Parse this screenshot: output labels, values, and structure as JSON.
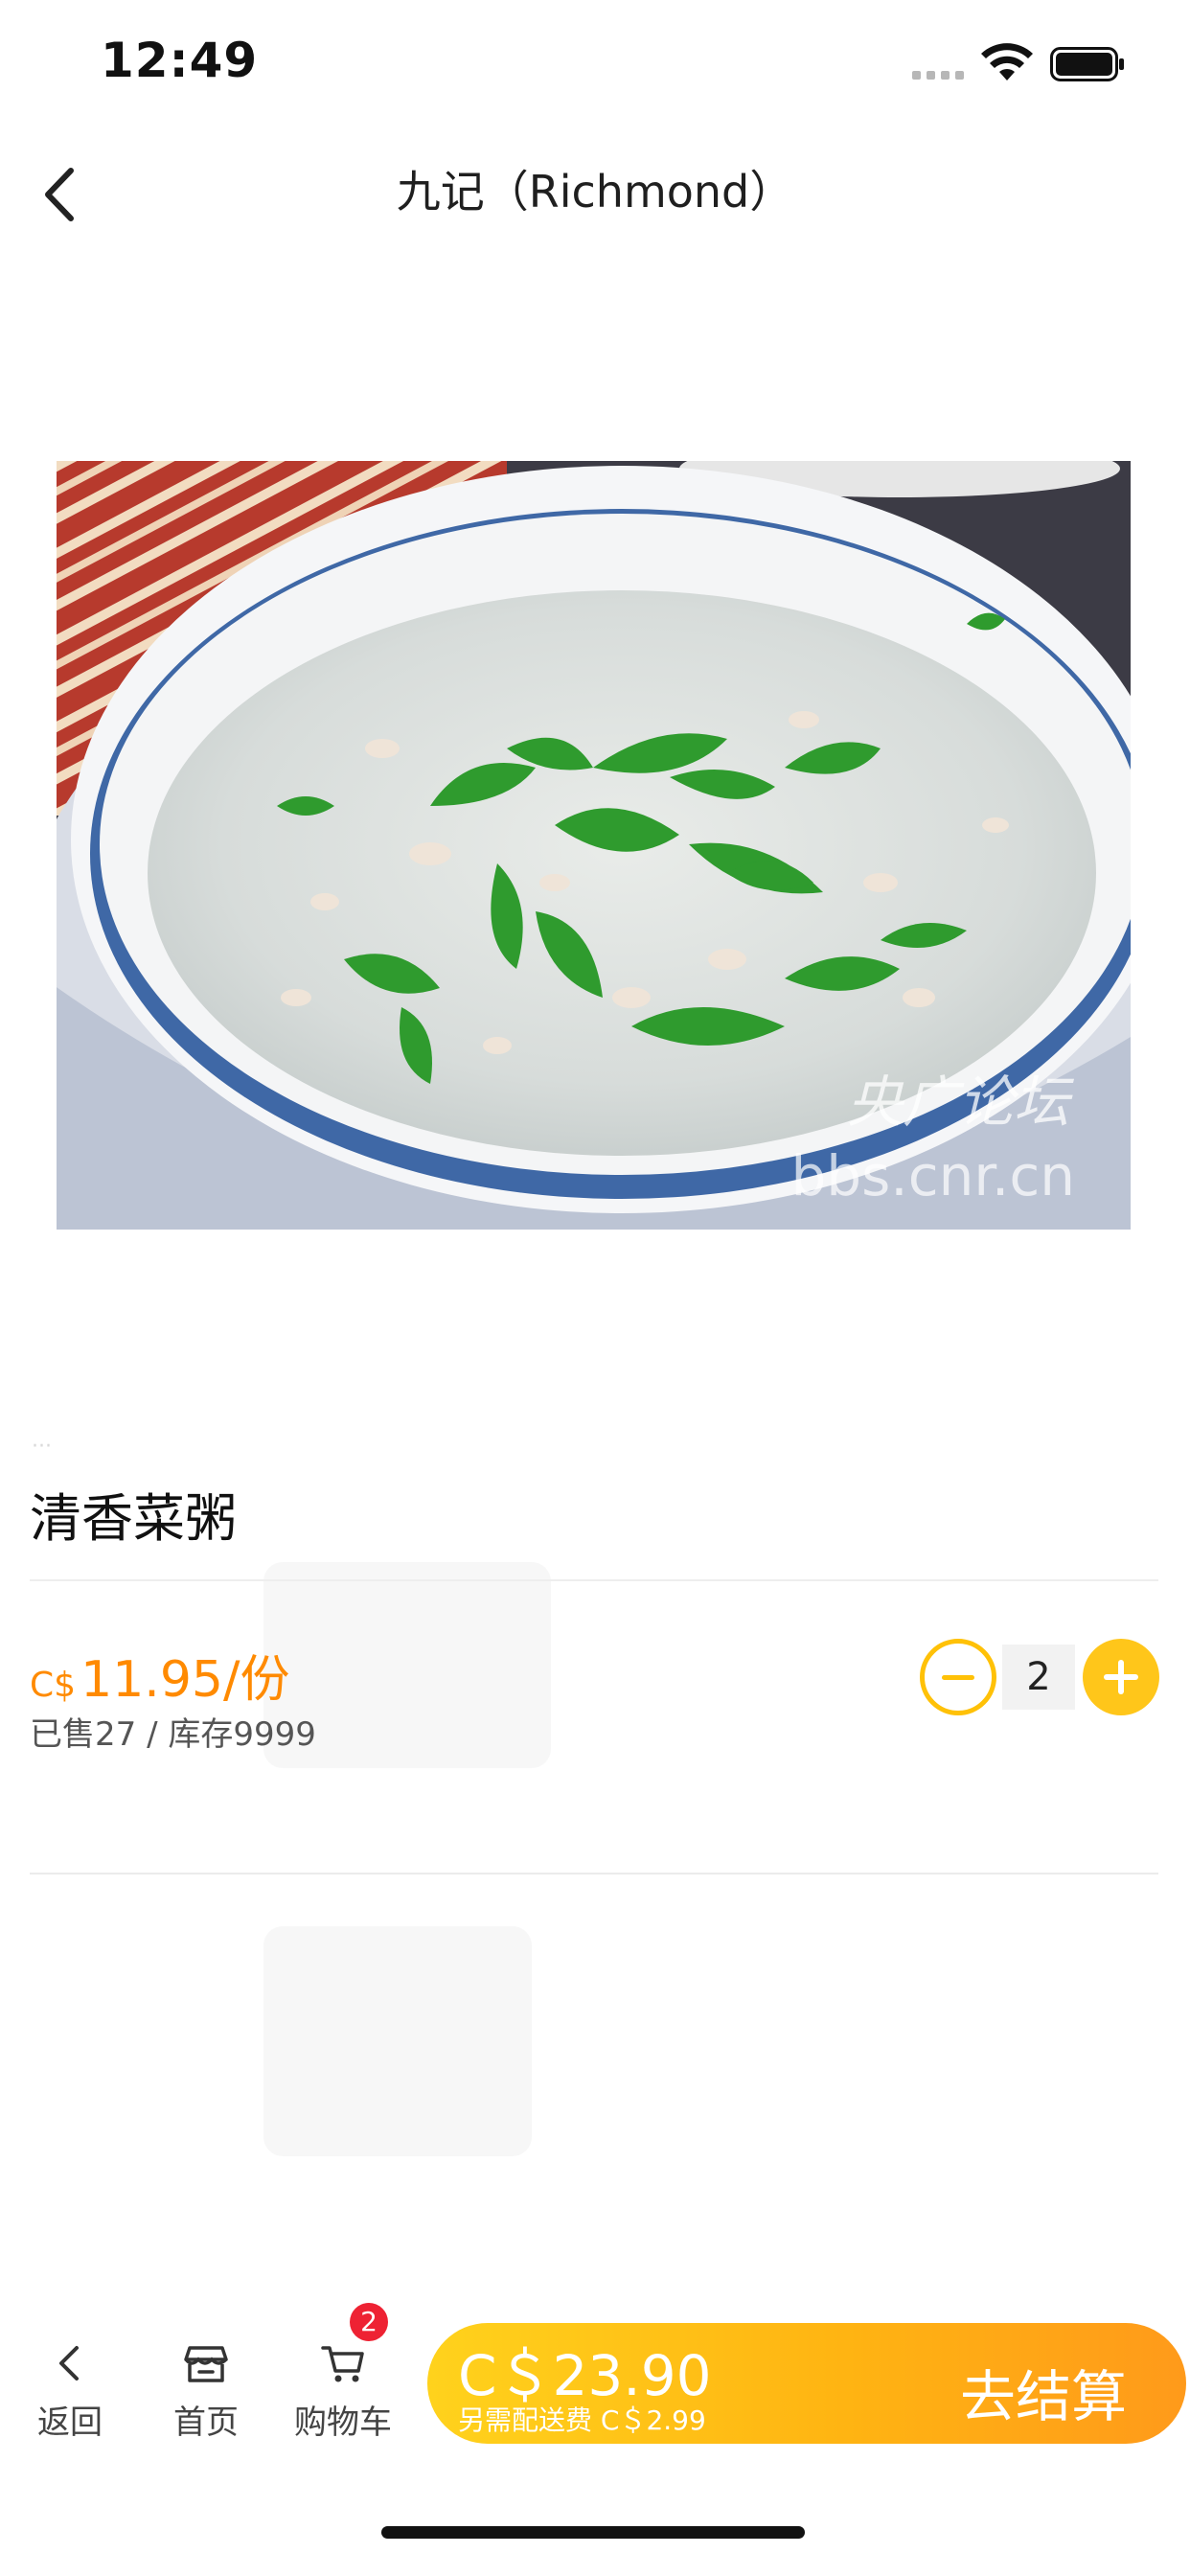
{
  "status_bar": {
    "time": "12:49"
  },
  "nav": {
    "title": "九记（Richmond）"
  },
  "hero": {
    "watermark_cn": "央广论坛",
    "watermark_url": "bbs.cnr.cn"
  },
  "product": {
    "name": "清香菜粥",
    "currency": "C$",
    "price": "11.95/份",
    "stock": "已售27 / 库存9999",
    "quantity": "2"
  },
  "tabbar": {
    "back_label": "返回",
    "home_label": "首页",
    "cart_label": "购物车",
    "cart_count": "2"
  },
  "checkout": {
    "total": "C＄23.90",
    "delivery_fee": "另需配送费 C＄2.99",
    "label": "去结算"
  },
  "colors": {
    "accent": "#ff8a00",
    "stepper": "#ffc107",
    "checkout_start": "#ffd21c",
    "checkout_end": "#ff9a1a",
    "badge": "#ee2233"
  }
}
